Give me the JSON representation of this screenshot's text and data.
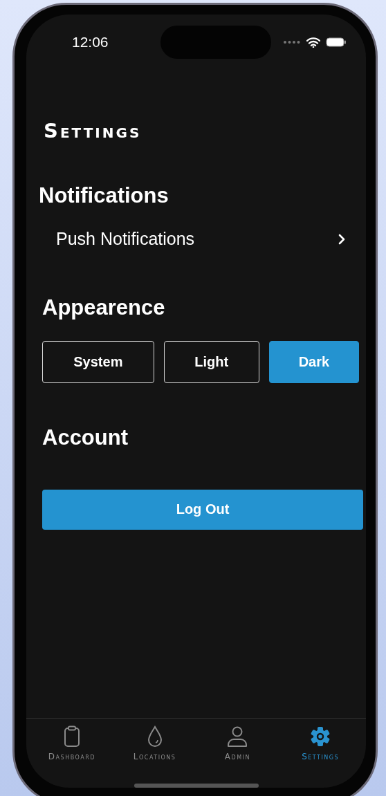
{
  "status_bar": {
    "time": "12:06"
  },
  "title": "Settings",
  "notifications": {
    "heading": "Notifications",
    "rows": [
      {
        "label": "Push Notifications"
      }
    ]
  },
  "appearance": {
    "heading": "Appearence",
    "options": [
      {
        "label": "System",
        "selected": false
      },
      {
        "label": "Light",
        "selected": false
      },
      {
        "label": "Dark",
        "selected": true
      }
    ]
  },
  "account": {
    "heading": "Account",
    "button": "Log Out"
  },
  "tab_bar": {
    "tabs": [
      {
        "label": "Dashboard",
        "kind": "clipboard",
        "selected": false
      },
      {
        "label": "Locations",
        "kind": "drop",
        "selected": false
      },
      {
        "label": "Admin",
        "kind": "person",
        "selected": false
      },
      {
        "label": "Settings",
        "kind": "gear",
        "selected": true
      }
    ]
  }
}
